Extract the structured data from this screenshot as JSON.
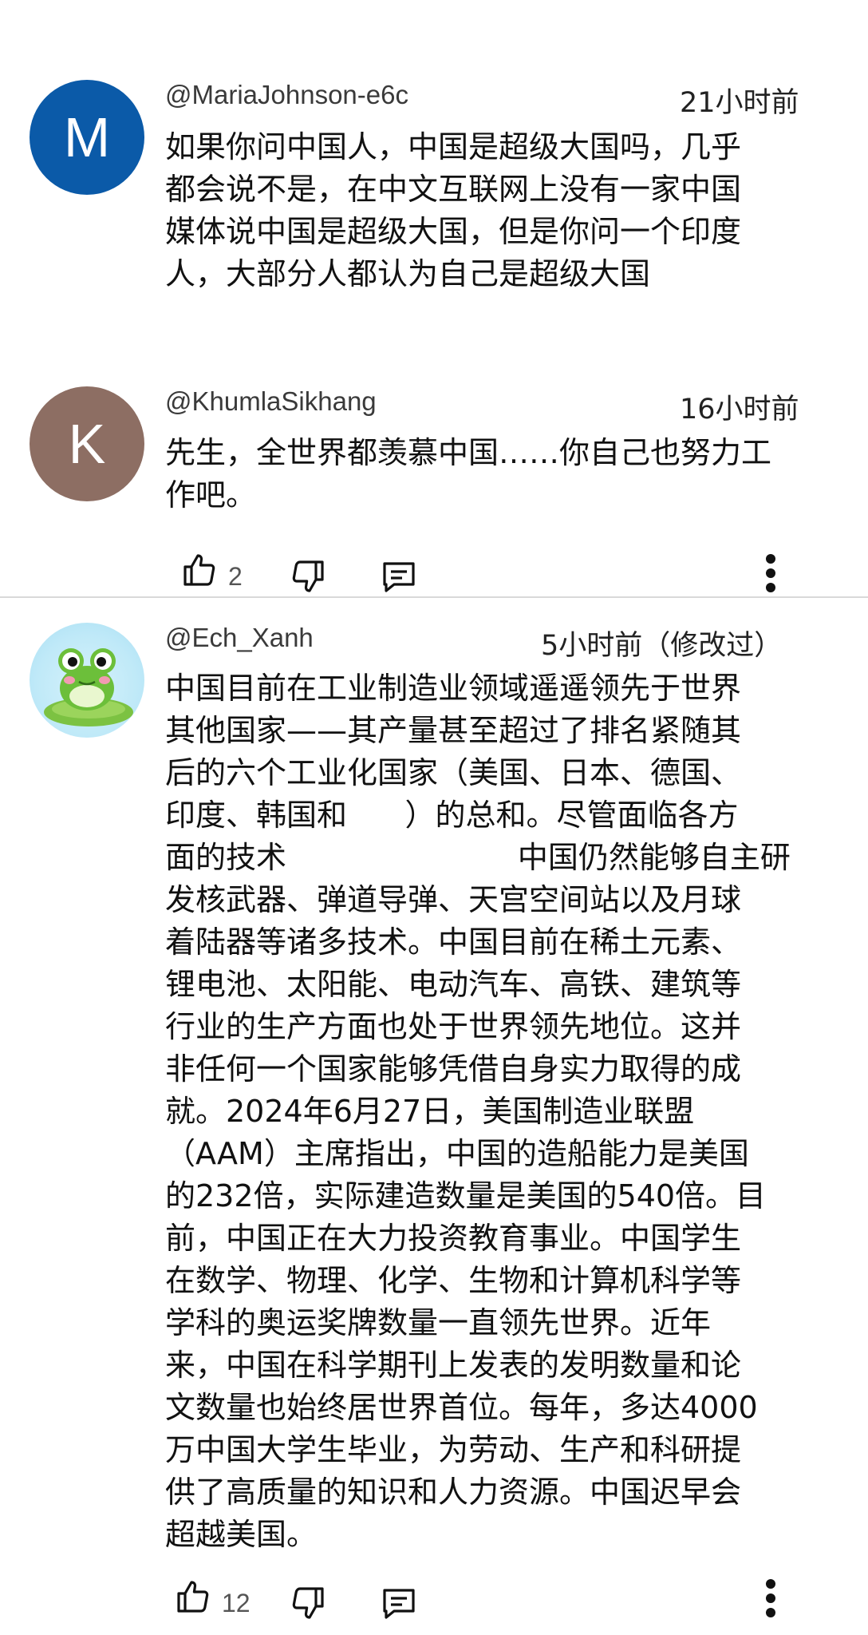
{
  "comments": [
    {
      "avatar_letter": "M",
      "avatar_color": "#0b5aa8",
      "handle": "@MariaJohnson-e6c",
      "time": "21小时前",
      "text": "如果你问中国人，中国是超级大国吗，几乎\n都会说不是，在中文互联网上没有一家中国\n媒体说中国是超级大国，但是你问一个印度\n人，大部分人都认为自己是超级大国"
    },
    {
      "avatar_letter": "K",
      "avatar_color": "#8d6e63",
      "handle": "@KhumlaSikhang",
      "time": "16小时前",
      "text": "先生，全世界都羡慕中国……你自己也努力工\n作吧。",
      "likes": "2"
    },
    {
      "avatar_icon": "frog-avatar",
      "handle": "@Ech_Xanh",
      "time": "5小时前（修改过）",
      "text": "中国目前在工业制造业领域遥遥领先于世界\n其他国家——其产量甚至超过了排名紧随其\n后的六个工业化国家（美国、日本、德国、\n印度、韩国和      ）的总和。尽管面临各方\n面的技术                        中国仍然能够自主研\n发核武器、弹道导弹、天宫空间站以及月球\n着陆器等诸多技术。中国目前在稀土元素、\n锂电池、太阳能、电动汽车、高铁、建筑等\n行业的生产方面也处于世界领先地位。这并\n非任何一个国家能够凭借自身实力取得的成\n就。2024年6月27日，美国制造业联盟\n（AAM）主席指出，中国的造船能力是美国\n的232倍，实际建造数量是美国的540倍。目\n前，中国正在大力投资教育事业。中国学生\n在数学、物理、化学、生物和计算机科学等\n学科的奥运奖牌数量一直领先世界。近年\n来，中国在科学期刊上发表的发明数量和论\n文数量也始终居世界首位。每年，多达4000\n万中国大学生毕业，为劳动、生产和科研提\n供了高质量的知识和人力资源。中国迟早会\n超越美国。",
      "likes": "12"
    }
  ],
  "icons": {
    "like": "thumbs-up-icon",
    "dislike": "thumbs-down-icon",
    "reply": "reply-icon",
    "more": "more-vert-icon"
  }
}
